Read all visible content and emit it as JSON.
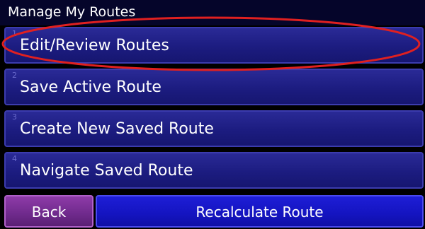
{
  "header": {
    "title": "Manage My Routes"
  },
  "menu": {
    "items": [
      {
        "number": "1",
        "label": "Edit/Review Routes",
        "highlighted": true
      },
      {
        "number": "2",
        "label": "Save Active Route"
      },
      {
        "number": "3",
        "label": "Create New Saved Route"
      },
      {
        "number": "4",
        "label": "Navigate Saved Route"
      }
    ]
  },
  "footer": {
    "back_label": "Back",
    "recalculate_label": "Recalculate Route"
  },
  "colors": {
    "background": "#000000",
    "menu_item": "#1c1c80",
    "back_button": "#6f2a8c",
    "recalculate_button": "#1414c0",
    "highlight_annotation": "#e02020"
  }
}
